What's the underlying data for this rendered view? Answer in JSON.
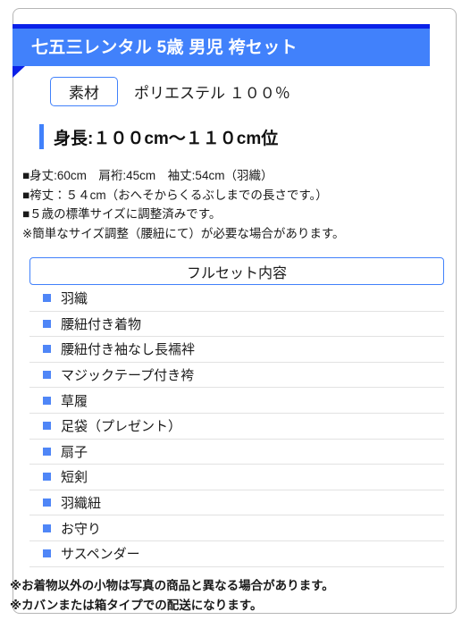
{
  "banner": {
    "title": "七五三レンタル 5歳 男児 袴セット",
    "color": "#4181fb",
    "fold_color": "#0a21e8"
  },
  "material": {
    "label": "素材",
    "value": "ポリエステル １００％"
  },
  "height": {
    "text": "身長:１００cm〜１１０cm位",
    "accent_color": "#4181fb"
  },
  "specs": {
    "lines": [
      "■身丈:60cm　肩裄:45cm　袖丈:54cm（羽織）",
      "■袴丈：５４cm（おへそからくるぶしまでの長さです。）",
      "■５歳の標準サイズに調整済みです。",
      "※簡単なサイズ調整（腰紐にて）が必要な場合があります。"
    ]
  },
  "fullset": {
    "header": "フルセット内容",
    "bullet_color": "#4f86f7",
    "items": [
      {
        "label": "羽織"
      },
      {
        "label": "腰紐付き着物"
      },
      {
        "label": "腰紐付き袖なし長襦袢"
      },
      {
        "label": "マジックテープ付き袴"
      },
      {
        "label": "草履"
      },
      {
        "label": "足袋（プレゼント）"
      },
      {
        "label": "扇子"
      },
      {
        "label": "短剣"
      },
      {
        "label": "羽織紐"
      },
      {
        "label": "お守り"
      },
      {
        "label": "サスペンダー"
      }
    ]
  },
  "footer": {
    "lines": [
      "※お着物以外の小物は写真の商品と異なる場合があります。",
      "※カバンまたは箱タイプでの配送になります。"
    ]
  }
}
